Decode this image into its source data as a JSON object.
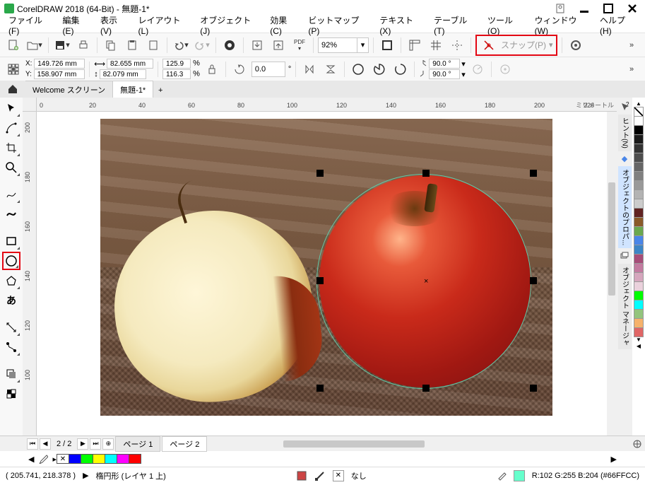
{
  "title": "CorelDRAW 2018 (64-Bit) - 無題-1*",
  "menu": {
    "file": "ファイル(F)",
    "edit": "編集(E)",
    "view": "表示(V)",
    "layout": "レイアウト(L)",
    "object": "オブジェクト(J)",
    "effect": "効果(C)",
    "bitmap": "ビットマップ(P)",
    "text": "テキスト(X)",
    "table": "テーブル(T)",
    "tool": "ツール(O)",
    "window": "ウィンドウ(W)",
    "help": "ヘルプ(H)"
  },
  "toolbar": {
    "zoom": "92%",
    "pdf": "PDF",
    "snap": "スナップ(P)"
  },
  "props": {
    "x_label": "X:",
    "y_label": "Y:",
    "x": "149.726 mm",
    "y": "158.907 mm",
    "w": "82.655 mm",
    "h": "82.079 mm",
    "sx": "125.9",
    "sy": "116.3",
    "pct": "%",
    "rot": "0.0",
    "deg": "°",
    "ang1": "90.0 °",
    "ang2": "90.0 °"
  },
  "tabs": {
    "welcome": "Welcome スクリーン",
    "doc": "無題-1*"
  },
  "ruler": {
    "unit": "ミリメートル",
    "h": [
      "0",
      "20",
      "40",
      "60",
      "80",
      "100",
      "120",
      "140",
      "160",
      "180",
      "200",
      "220"
    ],
    "v": [
      "200",
      "180",
      "160",
      "140",
      "120",
      "100"
    ]
  },
  "pager": {
    "counter": "2 / 2",
    "page1": "ページ 1",
    "page2": "ページ 2"
  },
  "status": {
    "cursor": "( 205.741, 218.378 )",
    "object": "楕円形 (レイヤ 1 上)",
    "nofill": "なし",
    "color": "R:102 G:255 B:204 (#66FFCC)"
  },
  "right_tabs": {
    "hint": "ヒント(N)",
    "obj_props": "オブジェクトのプロパ...",
    "obj_mgr": "オブジェクト マネージャ"
  },
  "palette_right": [
    "#ffffff",
    "#000000",
    "#1a1a1a",
    "#333333",
    "#4d4d4d",
    "#666666",
    "#808080",
    "#999999",
    "#b3b3b3",
    "#cccccc",
    "#612322",
    "#8a5a2a",
    "#6aa84f",
    "#4a86e8",
    "#3d85c6",
    "#a64d79",
    "#c27ba0",
    "#d5a6bd",
    "#ead1dc",
    "#00ff00",
    "#00ffff",
    "#93c47d",
    "#f6b26b",
    "#e06666"
  ],
  "palette_bottom": [
    "#0000ff",
    "#00ff00",
    "#ffff00",
    "#00ffff",
    "#ff00ff",
    "#ff0000"
  ]
}
